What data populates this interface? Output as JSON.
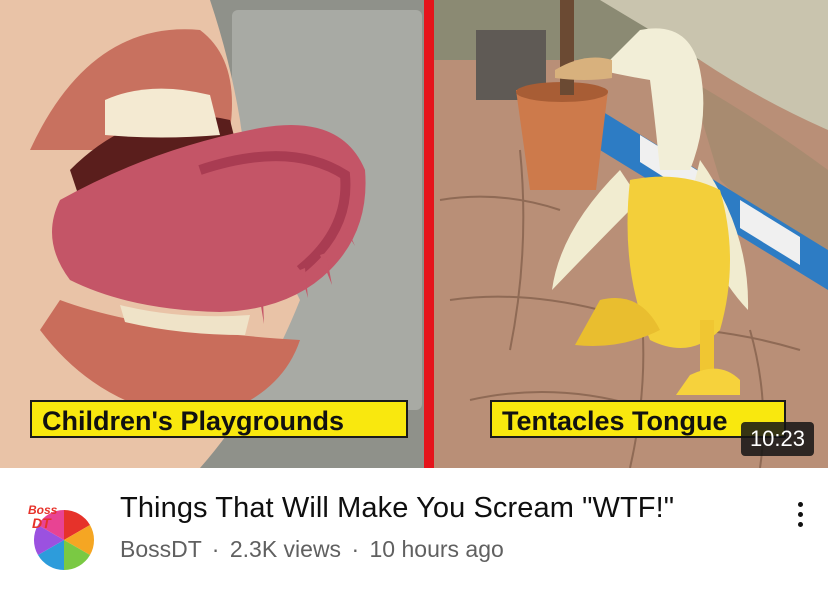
{
  "thumbnail": {
    "left_caption": "Children's Playgrounds",
    "right_caption": "Tentacles Tongue",
    "duration": "10:23"
  },
  "video": {
    "title": "Things That Will Make You Scream \"WTF!\"",
    "channel": "BossDT",
    "views": "2.3K views",
    "age": "10 hours ago",
    "separator": "·"
  },
  "avatar": {
    "logo_text_top": "Boss",
    "logo_text_bottom": "DT"
  },
  "icons": {
    "more": "more-vert-icon"
  },
  "colors": {
    "caption_bg": "#f9e80e",
    "divider_red": "#e5141b",
    "meta_text": "#606060"
  }
}
